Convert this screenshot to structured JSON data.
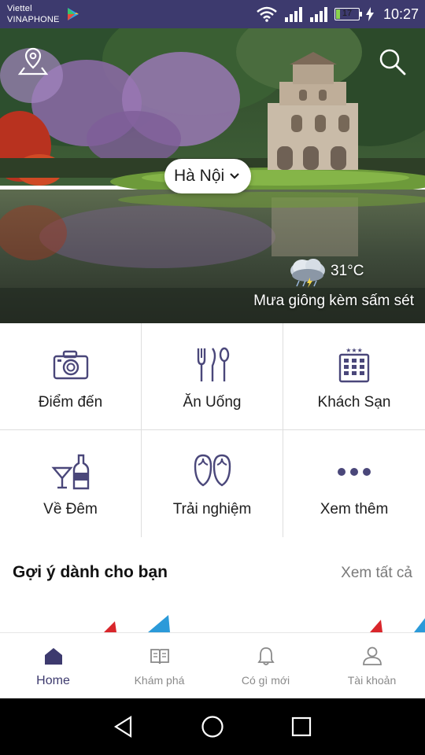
{
  "status_bar": {
    "carrier_1": "Viettel",
    "carrier_2": "VINAPHONE",
    "battery_level": "17",
    "battery_fraction": 0.17,
    "time": "10:27"
  },
  "hero": {
    "city": "Hà Nội",
    "temperature": "31°C",
    "weather_desc": "Mưa giông kèm sấm sét"
  },
  "categories": [
    {
      "label": "Điểm đến",
      "icon": "camera-icon"
    },
    {
      "label": "Ăn Uống",
      "icon": "cutlery-icon"
    },
    {
      "label": "Khách Sạn",
      "icon": "hotel-icon"
    },
    {
      "label": "Về Đêm",
      "icon": "cocktail-bottle-icon"
    },
    {
      "label": "Trải nghiệm",
      "icon": "flip-flops-icon"
    },
    {
      "label": "Xem thêm",
      "icon": "more-dots-icon"
    }
  ],
  "suggestions": {
    "title": "Gợi ý dành cho bạn",
    "see_all": "Xem tất cả"
  },
  "bottom_nav": [
    {
      "label": "Home",
      "icon": "home-icon",
      "active": true
    },
    {
      "label": "Khám phá",
      "icon": "book-icon",
      "active": false
    },
    {
      "label": "Có gì mới",
      "icon": "bell-icon",
      "active": false
    },
    {
      "label": "Tài khoản",
      "icon": "user-icon",
      "active": false
    }
  ],
  "colors": {
    "brand": "#3d3a6e",
    "icon": "#4a477a",
    "inactive": "#8a8a8a"
  }
}
